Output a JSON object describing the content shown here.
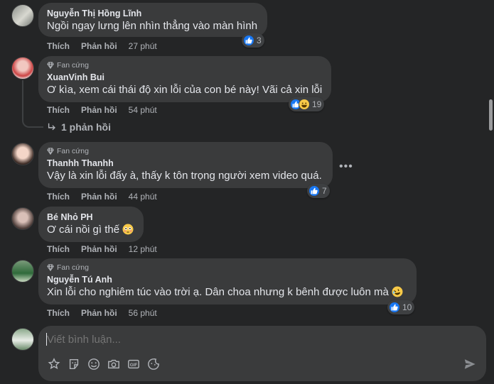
{
  "comments": [
    {
      "author": "Nguyễn Thị Hồng Lĩnh",
      "badge": "",
      "text": "Ngồi ngay lưng lên nhìn thẳng vào màn hình",
      "like_label": "Thích",
      "reply_label": "Phản hồi",
      "time": "27 phút",
      "reaction_count": "3",
      "reactions": [
        "like-icon"
      ]
    },
    {
      "author": "XuanVinh Bui",
      "badge": "Fan cứng",
      "text": "Ơ kìa, xem cái thái độ xin lỗi của con bé này! Vãi cả xin lỗi",
      "like_label": "Thích",
      "reply_label": "Phản hồi",
      "time": "54 phút",
      "reaction_count": "19",
      "reactions": [
        "like-icon",
        "haha-icon"
      ]
    },
    {
      "author": "Thanhh Thanhh",
      "badge": "Fan cứng",
      "text": "Vậy là xin lỗi đấy à, thấy k tôn trọng người xem video quá.",
      "like_label": "Thích",
      "reply_label": "Phản hồi",
      "time": "44 phút",
      "reaction_count": "7",
      "reactions": [
        "like-icon"
      ]
    },
    {
      "author": "Bé Nhỏ PH",
      "badge": "",
      "text": "Ơ cái nồi gì thế",
      "like_label": "Thích",
      "reply_label": "Phản hồi",
      "time": "12 phút",
      "reaction_count": "",
      "reactions": []
    },
    {
      "author": "Nguyễn Tú Anh",
      "badge": "Fan cứng",
      "text": "Xin lỗi cho nghiêm túc vào trời ạ. Dân choa nhưng k bênh được luôn mà",
      "like_label": "Thích",
      "reply_label": "Phản hồi",
      "time": "56 phút",
      "reaction_count": "10",
      "reactions": [
        "like-icon"
      ]
    }
  ],
  "replies_link": "1 phản hồi",
  "composer": {
    "placeholder": "Viết bình luận..."
  },
  "icons": {
    "badge": "diamond-icon",
    "reply_arrow": "reply-arrow-icon",
    "more": "more-options-icon",
    "send": "send-icon",
    "tools": [
      "avatar-sticker-icon",
      "sticker-icon",
      "emoji-icon",
      "camera-icon",
      "gif-icon",
      "sticker-pack-icon"
    ]
  },
  "colors": {
    "background": "#242526",
    "bubble": "#3a3b3c",
    "text": "#e4e6eb",
    "secondary_text": "#b0b3b8",
    "like_blue": "#1877f2",
    "haha_yellow": "#f7c948"
  }
}
